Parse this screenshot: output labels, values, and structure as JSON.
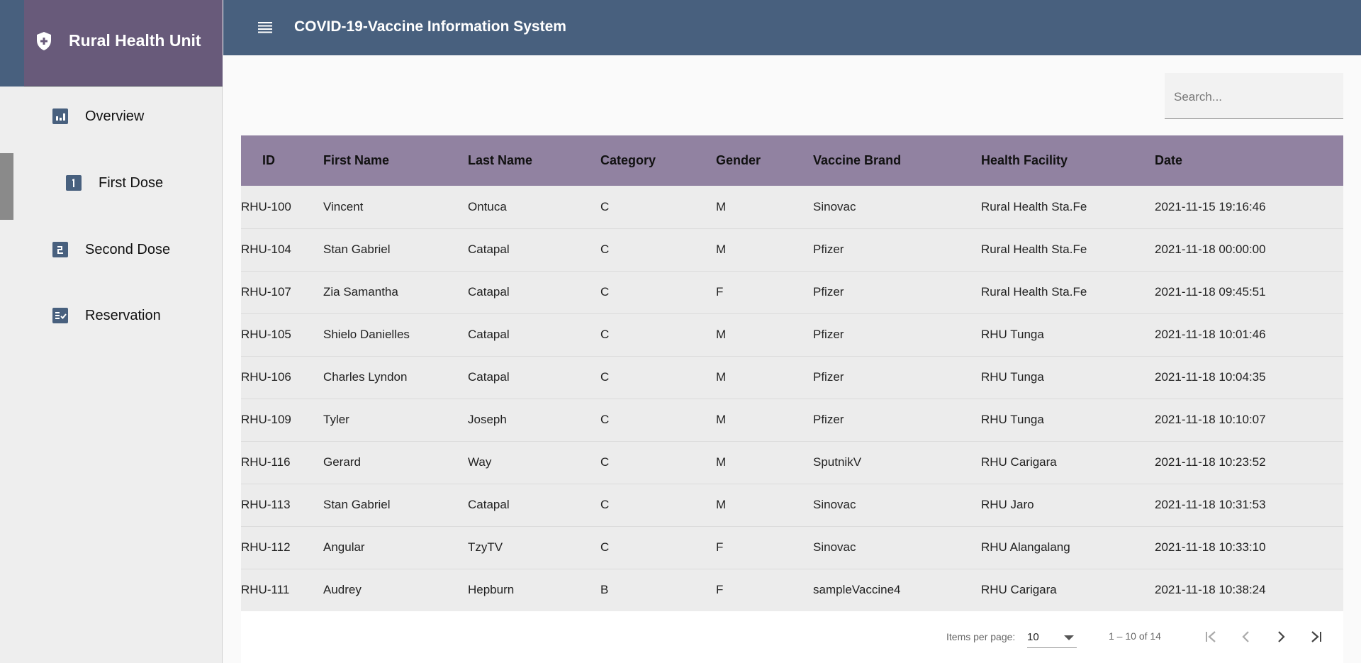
{
  "sidebar": {
    "brand_title": "Rural Health Unit",
    "items": [
      {
        "label": "Overview",
        "icon": "chart-icon"
      },
      {
        "label": "First Dose",
        "icon": "number-one-icon"
      },
      {
        "label": "Second Dose",
        "icon": "number-two-icon"
      },
      {
        "label": "Reservation",
        "icon": "checklist-icon"
      }
    ]
  },
  "header": {
    "title": "COVID-19-Vaccine Information System"
  },
  "search": {
    "placeholder": "Search..."
  },
  "table": {
    "columns": [
      "ID",
      "First Name",
      "Last Name",
      "Category",
      "Gender",
      "Vaccine Brand",
      "Health Facility",
      "Date"
    ],
    "rows": [
      [
        "RHU-100",
        "Vincent",
        "Ontuca",
        "C",
        "M",
        "Sinovac",
        "Rural Health Sta.Fe",
        "2021-11-15 19:16:46"
      ],
      [
        "RHU-104",
        "Stan Gabriel",
        "Catapal",
        "C",
        "M",
        "Pfizer",
        "Rural Health Sta.Fe",
        "2021-11-18 00:00:00"
      ],
      [
        "RHU-107",
        "Zia Samantha",
        "Catapal",
        "C",
        "F",
        "Pfizer",
        "Rural Health Sta.Fe",
        "2021-11-18 09:45:51"
      ],
      [
        "RHU-105",
        "Shielo Danielles",
        "Catapal",
        "C",
        "M",
        "Pfizer",
        "RHU Tunga",
        "2021-11-18 10:01:46"
      ],
      [
        "RHU-106",
        "Charles Lyndon",
        "Catapal",
        "C",
        "M",
        "Pfizer",
        "RHU Tunga",
        "2021-11-18 10:04:35"
      ],
      [
        "RHU-109",
        "Tyler",
        "Joseph",
        "C",
        "M",
        "Pfizer",
        "RHU Tunga",
        "2021-11-18 10:10:07"
      ],
      [
        "RHU-116",
        "Gerard",
        "Way",
        "C",
        "M",
        "SputnikV",
        "RHU Carigara",
        "2021-11-18 10:23:52"
      ],
      [
        "RHU-113",
        "Stan Gabriel",
        "Catapal",
        "C",
        "M",
        "Sinovac",
        "RHU Jaro",
        "2021-11-18 10:31:53"
      ],
      [
        "RHU-112",
        "Angular",
        "TzyTV",
        "C",
        "F",
        "Sinovac",
        "RHU Alangalang",
        "2021-11-18 10:33:10"
      ],
      [
        "RHU-111",
        "Audrey",
        "Hepburn",
        "B",
        "F",
        "sampleVaccine4",
        "RHU Carigara",
        "2021-11-18 10:38:24"
      ]
    ]
  },
  "paginator": {
    "items_per_page_label": "Items per page:",
    "items_per_page_value": "10",
    "range_label": "1 – 10 of 14"
  },
  "colors": {
    "header": "#48607e",
    "brand": "#685a7a",
    "table_header": "#9182a1",
    "sidebar": "#eeeeee"
  }
}
